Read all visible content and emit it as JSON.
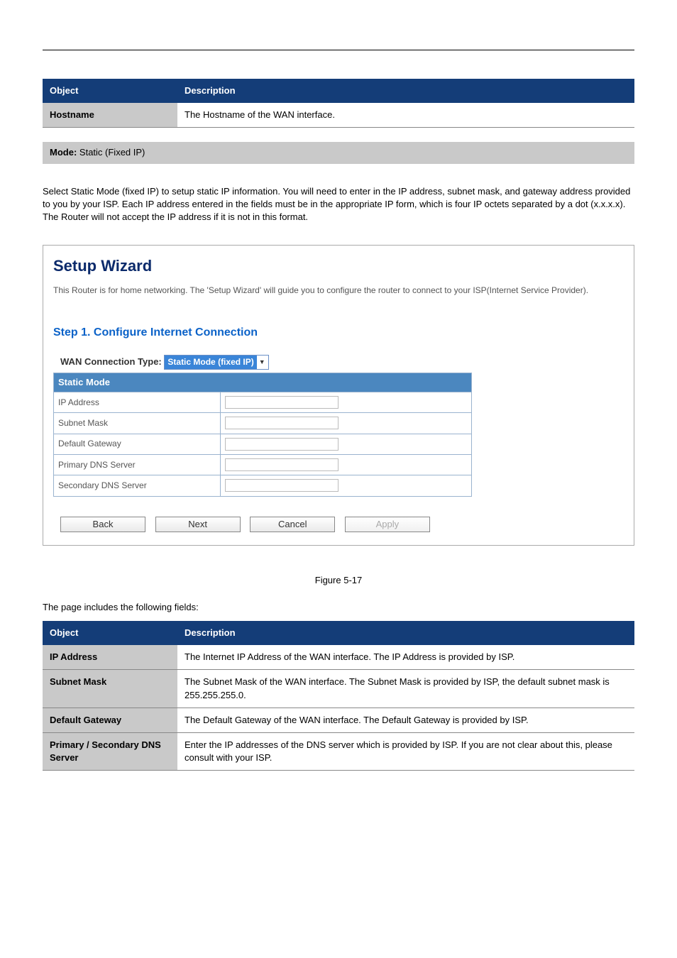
{
  "top_table": {
    "headers": [
      "Object",
      "Description"
    ],
    "rows": [
      {
        "object": "Hostname",
        "desc": "The Hostname of the WAN interface."
      }
    ]
  },
  "mode_bar": {
    "prefix": "Mode:",
    "mode": "Static (Fixed IP)"
  },
  "intro_text": "Select Static Mode (fixed IP) to setup static IP information. You will need to enter in the IP address, subnet mask, and gateway address provided to you by your ISP. Each IP address entered in the fields must be in the appropriate IP form, which is four IP octets separated by a dot (x.x.x.x). The Router will not accept the IP address if it is not in this format.",
  "wizard": {
    "title": "Setup Wizard",
    "desc": "This Router is for home networking. The 'Setup Wizard' will guide you to configure the router to connect to your ISP(Internet Service Provider).",
    "step_title": "Step 1. Configure Internet Connection",
    "wan_label": "WAN Connection Type:",
    "wan_value": "Static Mode (fixed IP)",
    "section_header": "Static Mode",
    "fields": [
      {
        "label": "IP Address",
        "value": ""
      },
      {
        "label": "Subnet Mask",
        "value": ""
      },
      {
        "label": "Default Gateway",
        "value": ""
      },
      {
        "label": "Primary DNS Server",
        "value": ""
      },
      {
        "label": "Secondary DNS Server",
        "value": ""
      }
    ],
    "buttons": {
      "back": "Back",
      "next": "Next",
      "cancel": "Cancel",
      "apply": "Apply"
    }
  },
  "figure_caption": "Figure 5-17",
  "bottom_para": "The page includes the following fields:",
  "bottom_table": {
    "headers": [
      "Object",
      "Description"
    ],
    "rows": [
      {
        "object": "IP Address",
        "desc": "The Internet IP Address of the WAN interface. The IP Address is provided by ISP."
      },
      {
        "object": "Subnet Mask",
        "desc": "The Subnet Mask of the WAN interface. The Subnet Mask is provided by ISP, the default subnet mask is 255.255.255.0."
      },
      {
        "object": "Default Gateway",
        "desc": "The Default Gateway of the WAN interface. The Default Gateway is provided by ISP."
      },
      {
        "object": "Primary / Secondary DNS Server",
        "desc": "Enter the IP addresses of the DNS server which is provided by ISP. If you are not clear about this, please consult with your ISP."
      }
    ]
  }
}
